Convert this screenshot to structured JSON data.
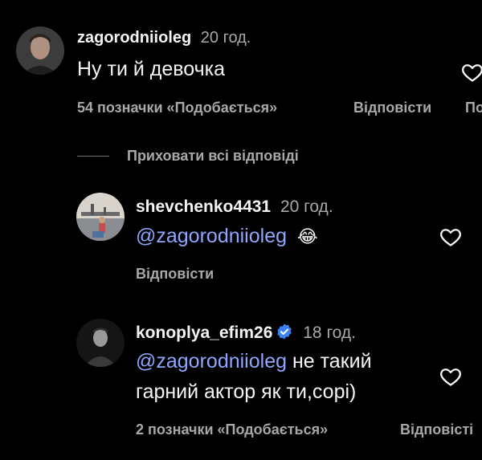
{
  "comment": {
    "username": "zagorodniioleg",
    "time": "20 год.",
    "text": "Ну ти й девочка",
    "likes": "54 позначки «Подобається»",
    "reply": "Відповісти",
    "more": "По"
  },
  "hide_replies": "Приховати всі відповіді",
  "replies": [
    {
      "username": "shevchenko4431",
      "time": "20 год.",
      "mention": "@zagorodniioleg",
      "emoji": "😂",
      "reply": "Відповісти"
    },
    {
      "username": "konoplya_efim26",
      "time": "18 год.",
      "mention": "@zagorodniioleg",
      "text_line1": " не такий",
      "text_line2": "гарний актор як ти,сорі)",
      "likes": "2 позначки «Подобається»",
      "reply": "Відповісті"
    }
  ],
  "colors": {
    "background": "#000000",
    "mention": "#8fa6ff",
    "secondary_text": "#a8a8a8",
    "verified": "#3b82f6"
  }
}
